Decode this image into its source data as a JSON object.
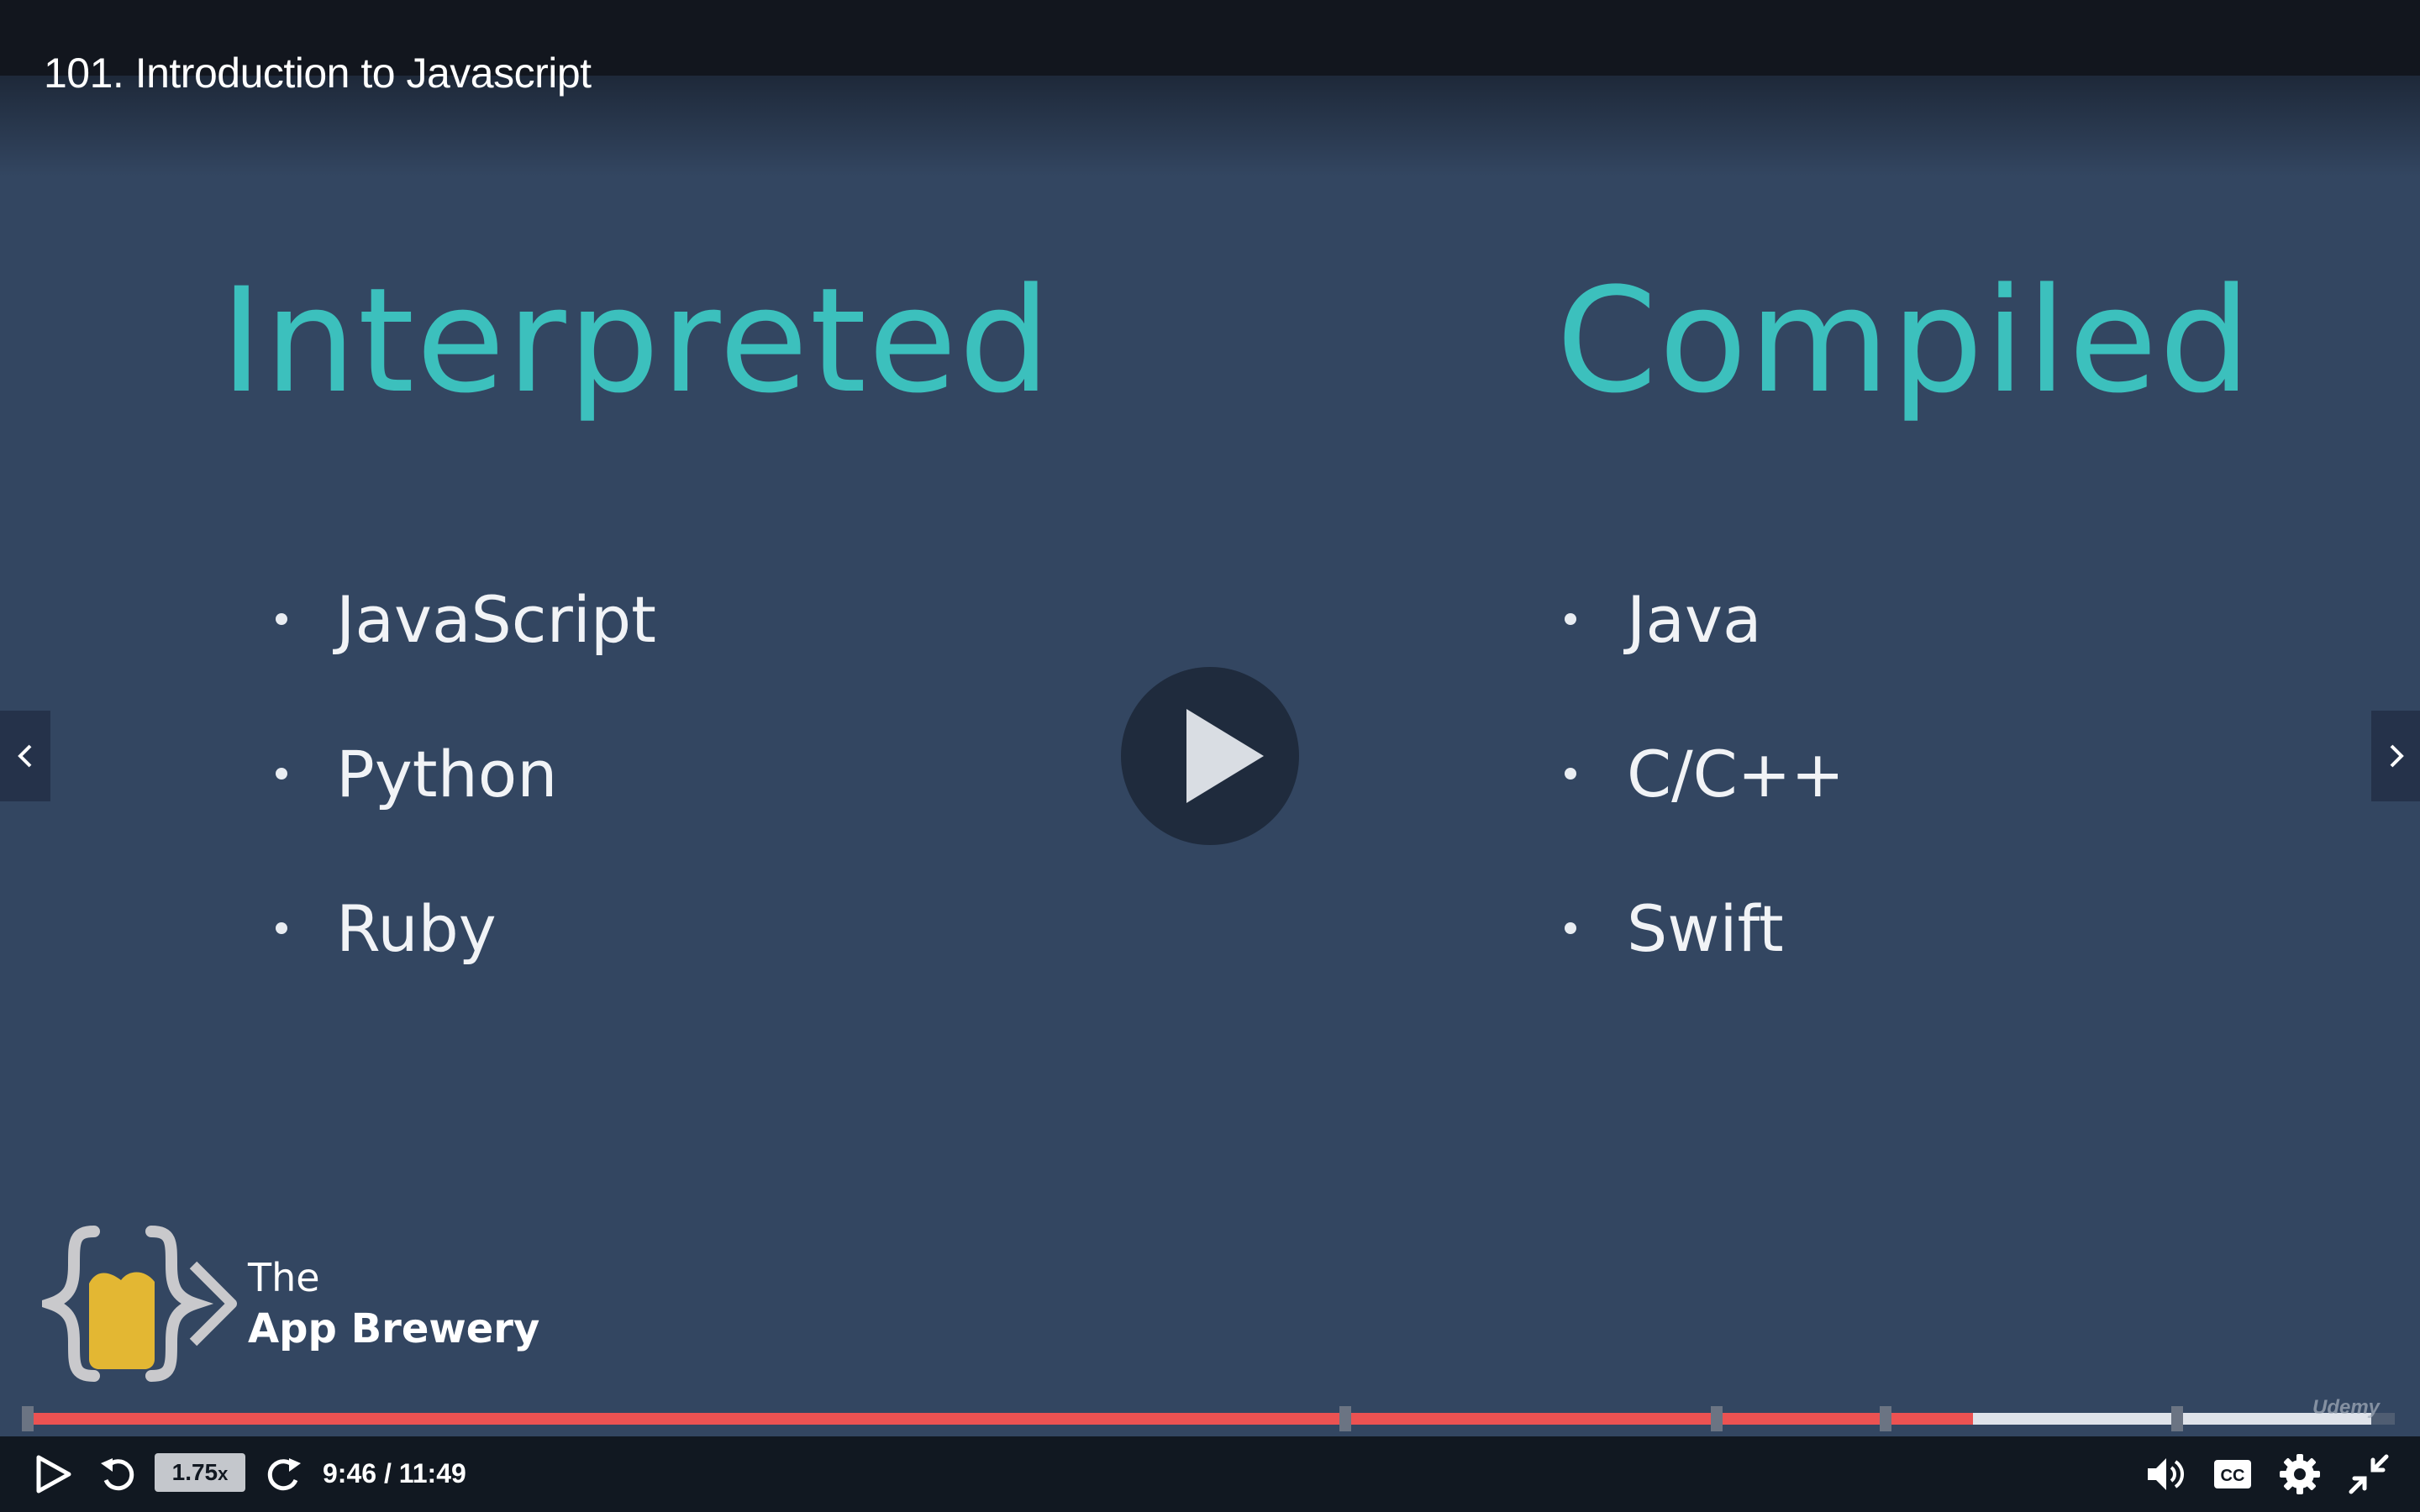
{
  "header": {
    "lecture_title": "101. Introduction to Javascript"
  },
  "slide": {
    "left_column": {
      "heading": "Interpreted",
      "items": [
        "JavaScript",
        "Python",
        "Ruby"
      ]
    },
    "right_column": {
      "heading": "Compiled",
      "items": [
        "Java",
        "C/C++",
        "Swift"
      ]
    },
    "brand": {
      "the": "The",
      "name": "App Brewery"
    },
    "colors": {
      "heading": "#3cc0bd",
      "background": "#334661",
      "logo_yellow": "#e3b733"
    }
  },
  "player": {
    "big_play_icon": "play-icon",
    "prev_icon": "chevron-left-icon",
    "next_icon": "chevron-right-icon",
    "watermark": "Udemy",
    "progress": {
      "played_fraction": 0.822,
      "buffered_fraction": 0.99,
      "chapter_markers": [
        0.001,
        0.557,
        0.714,
        0.785,
        0.908
      ],
      "played_color": "#ec5252"
    },
    "controls": {
      "speed": "1.75",
      "speed_suffix": "x",
      "time": "9:46 / 11:49",
      "icons": [
        "play-icon",
        "rewind-icon",
        "forward-icon",
        "volume-icon",
        "cc-icon",
        "gear-icon",
        "exit-fullscreen-icon"
      ]
    }
  }
}
